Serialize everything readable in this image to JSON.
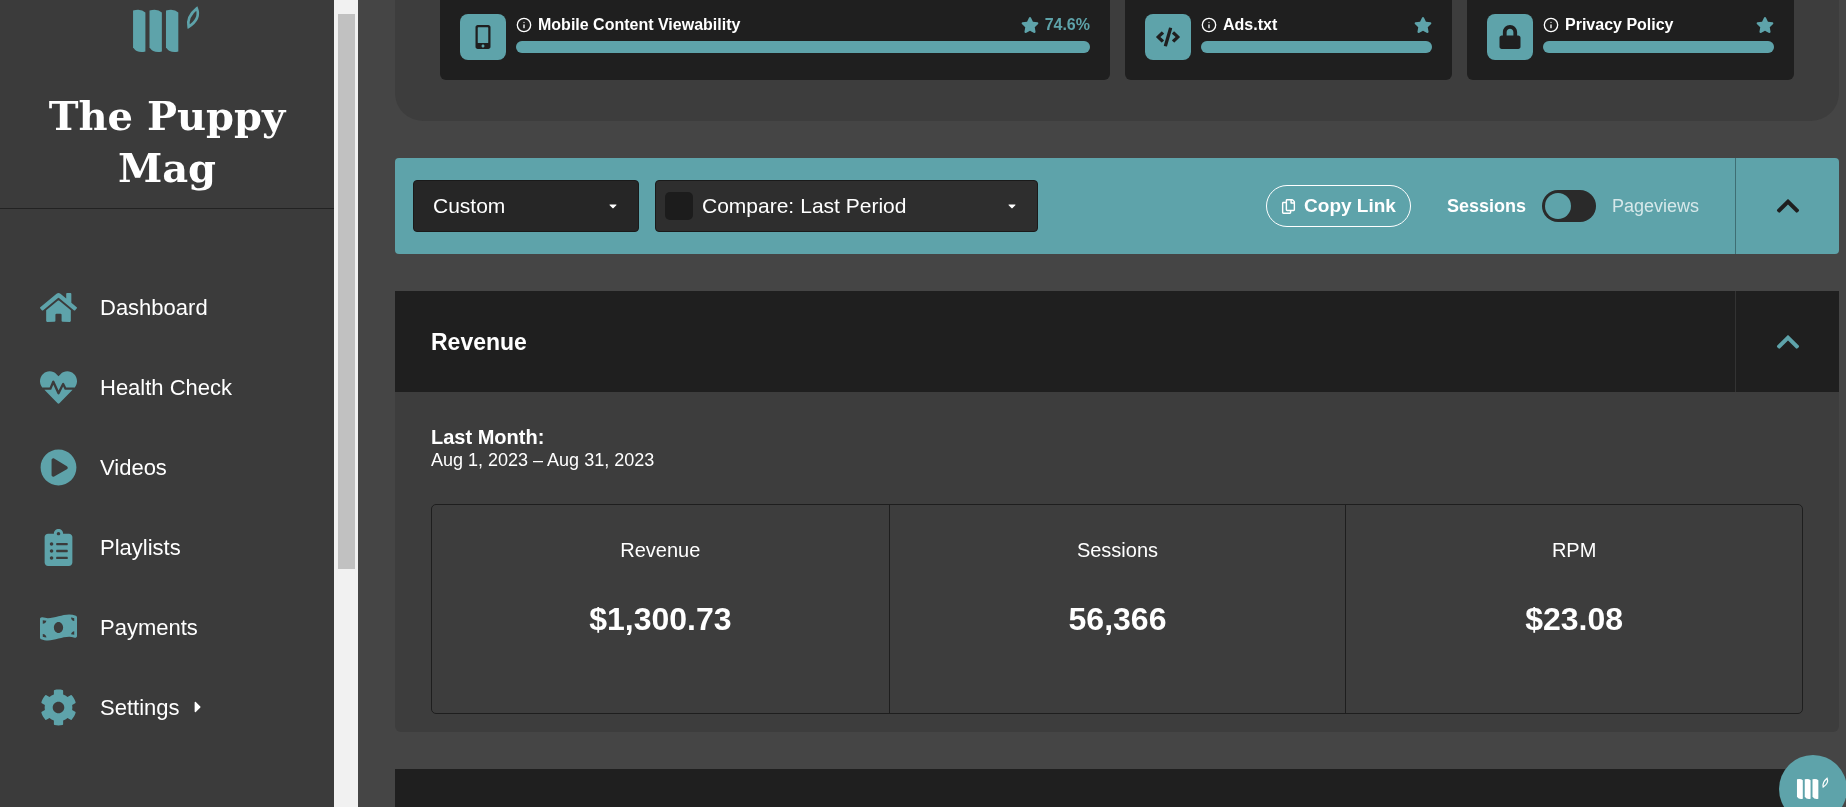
{
  "sidebar": {
    "title": "The Puppy Mag",
    "items": [
      {
        "label": "Dashboard",
        "has_submenu": false
      },
      {
        "label": "Health Check",
        "has_submenu": false
      },
      {
        "label": "Videos",
        "has_submenu": false
      },
      {
        "label": "Playlists",
        "has_submenu": false
      },
      {
        "label": "Payments",
        "has_submenu": false
      },
      {
        "label": "Settings",
        "has_submenu": true
      }
    ]
  },
  "health_checks": [
    {
      "label": "Mobile Content Viewability",
      "score": "74.6%",
      "level": 1
    },
    {
      "label": "Ads.txt",
      "level": 1
    },
    {
      "label": "Privacy Policy",
      "level": 1
    }
  ],
  "toolbar": {
    "date_range": "Custom",
    "compare_checked": false,
    "compare_label": "Compare:",
    "compare_value": "Last Period",
    "copy_link": "Copy Link",
    "toggle_left": "Sessions",
    "toggle_right": "Pageviews",
    "toggle_on": false
  },
  "revenue": {
    "title": "Revenue",
    "period_label": "Last Month:",
    "period_dates": "Aug 1, 2023 – Aug 31, 2023",
    "metrics": [
      {
        "label": "Revenue",
        "value": "$1,300.73"
      },
      {
        "label": "Sessions",
        "value": "56,366"
      },
      {
        "label": "RPM",
        "value": "$23.08"
      }
    ]
  }
}
